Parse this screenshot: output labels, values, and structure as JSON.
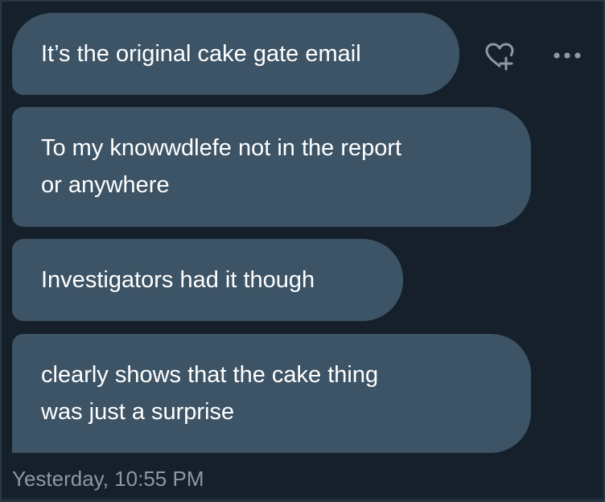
{
  "messages": [
    {
      "lines": [
        "It’s the original cake gate email"
      ]
    },
    {
      "lines": [
        "To my knowwdlefe not in the report",
        "or anywhere"
      ]
    },
    {
      "lines": [
        "Investigators had it though"
      ]
    },
    {
      "lines": [
        "clearly shows that the cake thing",
        "was just a surprise"
      ]
    }
  ],
  "timestamp": "Yesterday, 10:55 PM",
  "actions": {
    "react_icon": "heart-plus-icon",
    "more_icon": "more-horizontal-icon"
  },
  "colors": {
    "background": "#15202b",
    "bubble": "#3d5466",
    "text": "#ffffff",
    "muted": "#8b98a5"
  }
}
